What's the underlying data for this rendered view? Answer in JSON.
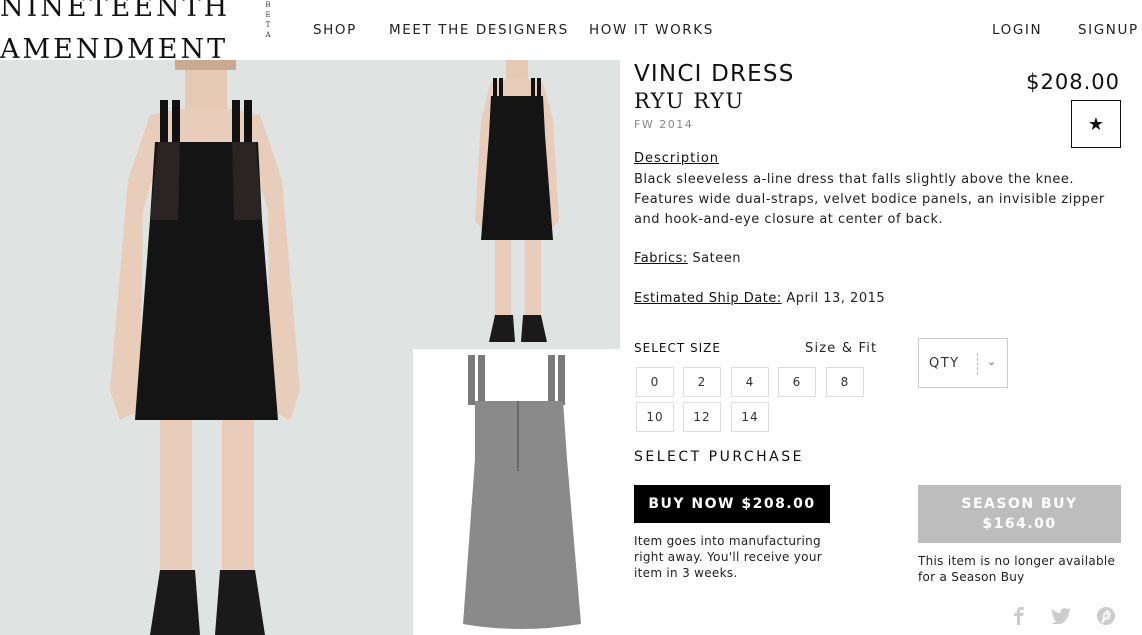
{
  "brand": {
    "line1": "NINETEENTH",
    "line2": "AMENDMENT",
    "beta": "BETA"
  },
  "nav": {
    "shop": "SHOP",
    "designers": "MEET THE DESIGNERS",
    "how": "HOW IT WORKS",
    "login": "LOGIN",
    "signup": "SIGNUP"
  },
  "product": {
    "name": "VINCI DRESS",
    "designer": "RYU RYU",
    "season": "FW 2014",
    "price": "$208.00",
    "description_label": "Description",
    "description": "Black sleeveless a-line dress that falls slightly above the knee. Features wide dual-straps, velvet bodice panels, an invisible zipper and hook-and-eye closure at center of back.",
    "fabrics_label": "Fabrics:",
    "fabrics": "Sateen",
    "ship_label": "Estimated Ship Date:",
    "ship_date": "April 13, 2015"
  },
  "sizes": {
    "label": "SELECT SIZE",
    "fit_link": "Size & Fit",
    "options": [
      "0",
      "2",
      "4",
      "6",
      "8",
      "10",
      "12",
      "14"
    ]
  },
  "qty": {
    "label": "QTY"
  },
  "purchase": {
    "label": "SELECT PURCHASE",
    "buy_now": "BUY NOW $208.00",
    "buy_note": "Item goes into manufacturing right away. You'll receive your item in 3 weeks.",
    "season_line1": "SEASON BUY",
    "season_line2": "$164.00",
    "season_note": "This item is no longer available for a Season Buy"
  },
  "icons": {
    "favorite": "star-icon",
    "qty_dropdown": "chevron-down-icon",
    "share": [
      "facebook-icon",
      "twitter-icon",
      "pinterest-icon"
    ]
  },
  "colors": {
    "buy_button": "#000000",
    "season_button_disabled": "#bdbdbd",
    "image_bg": "#dfe3e1"
  }
}
